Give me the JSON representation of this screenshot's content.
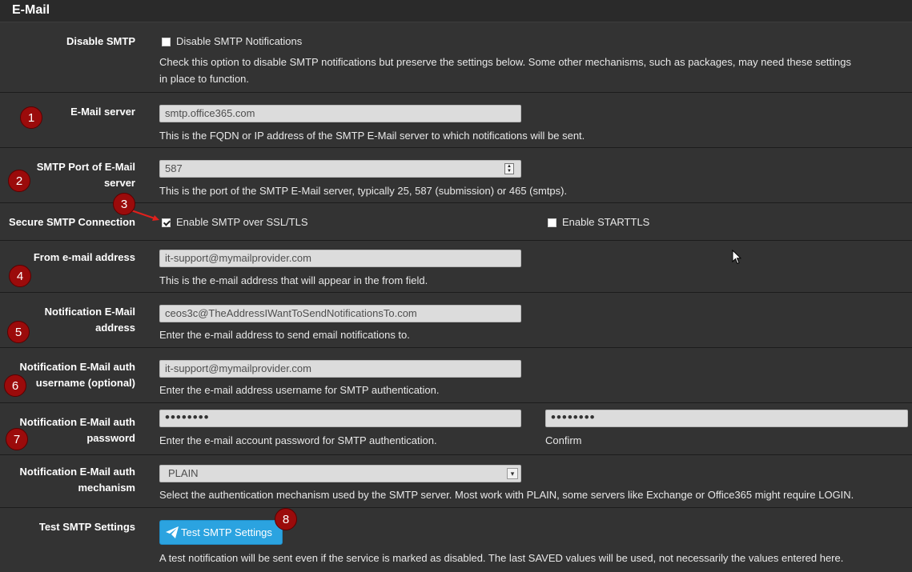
{
  "section_title": "E-Mail",
  "disable_smtp": {
    "label": "Disable SMTP",
    "checkbox_label": "Disable SMTP Notifications",
    "checked": false,
    "help_line1": "Check this option to disable SMTP notifications but preserve the settings below. Some other mechanisms, such as packages, may need these settings",
    "help_line2": "in place to function."
  },
  "email_server": {
    "label": "E-Mail server",
    "value": "smtp.office365.com",
    "help": "This is the FQDN or IP address of the SMTP E-Mail server to which notifications will be sent."
  },
  "smtp_port": {
    "label_line1": "SMTP Port of E-Mail",
    "label_line2": "server",
    "value": "587",
    "help": "This is the port of the SMTP E-Mail server, typically 25, 587 (submission) or 465 (smtps)."
  },
  "secure": {
    "label": "Secure SMTP Connection",
    "ssl_label": "Enable SMTP over SSL/TLS",
    "ssl_checked": true,
    "starttls_label": "Enable STARTTLS",
    "starttls_checked": false
  },
  "from_address": {
    "label": "From e-mail address",
    "value": "it-support@mymailprovider.com",
    "help": "This is the e-mail address that will appear in the from field."
  },
  "notification_address": {
    "label_line1": "Notification E-Mail",
    "label_line2": "address",
    "value": "ceos3c@TheAddressIWantToSendNotificationsTo.com",
    "help": "Enter the e-mail address to send email notifications to."
  },
  "auth_username": {
    "label_line1": "Notification E-Mail auth",
    "label_line2": "username (optional)",
    "value": "it-support@mymailprovider.com",
    "help": "Enter the e-mail address username for SMTP authentication."
  },
  "auth_password": {
    "label_line1": "Notification E-Mail auth",
    "label_line2": "password",
    "value": "••••••••",
    "confirm_value": "••••••••",
    "help": "Enter the e-mail account password for SMTP authentication.",
    "confirm_label": "Confirm"
  },
  "auth_mechanism": {
    "label_line1": "Notification E-Mail auth",
    "label_line2": "mechanism",
    "selected": "PLAIN",
    "help": "Select the authentication mechanism used by the SMTP server. Most work with PLAIN, some servers like Exchange or Office365 might require LOGIN."
  },
  "test_smtp": {
    "label": "Test SMTP Settings",
    "button_label": "Test SMTP Settings",
    "help": "A test notification will be sent even if the service is marked as disabled. The last SAVED values will be used, not necessarily the values entered here."
  },
  "annotations": [
    "1",
    "2",
    "3",
    "4",
    "5",
    "6",
    "7",
    "8"
  ],
  "colors": {
    "background": "#333333",
    "badge": "#9b0b0b",
    "button": "#2ba3e0",
    "arrow": "#e0201c"
  }
}
